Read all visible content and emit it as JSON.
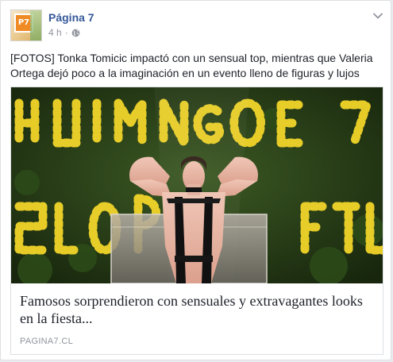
{
  "post": {
    "page_name": "Página 7",
    "avatar_logo": "P7",
    "time": "4 h",
    "separator": "·",
    "privacy_icon": "globe-icon",
    "menu_icon": "chevron-down-icon",
    "text": "[FOTOS] Tonka Tomicic impactó con un sensual top, mientras que Valeria Ortega dejó poco a la imaginación en un evento lleno de figuras y lujos"
  },
  "link": {
    "title": "Famosos sorprendieron con sensuales y extravagantes looks en la fiesta...",
    "domain": "PAGINA7.CL"
  },
  "colors": {
    "page_name": "#365899",
    "meta": "#90949c",
    "text": "#1d2129",
    "border": "#dddfe2",
    "logo_orange": "#f08a24"
  }
}
